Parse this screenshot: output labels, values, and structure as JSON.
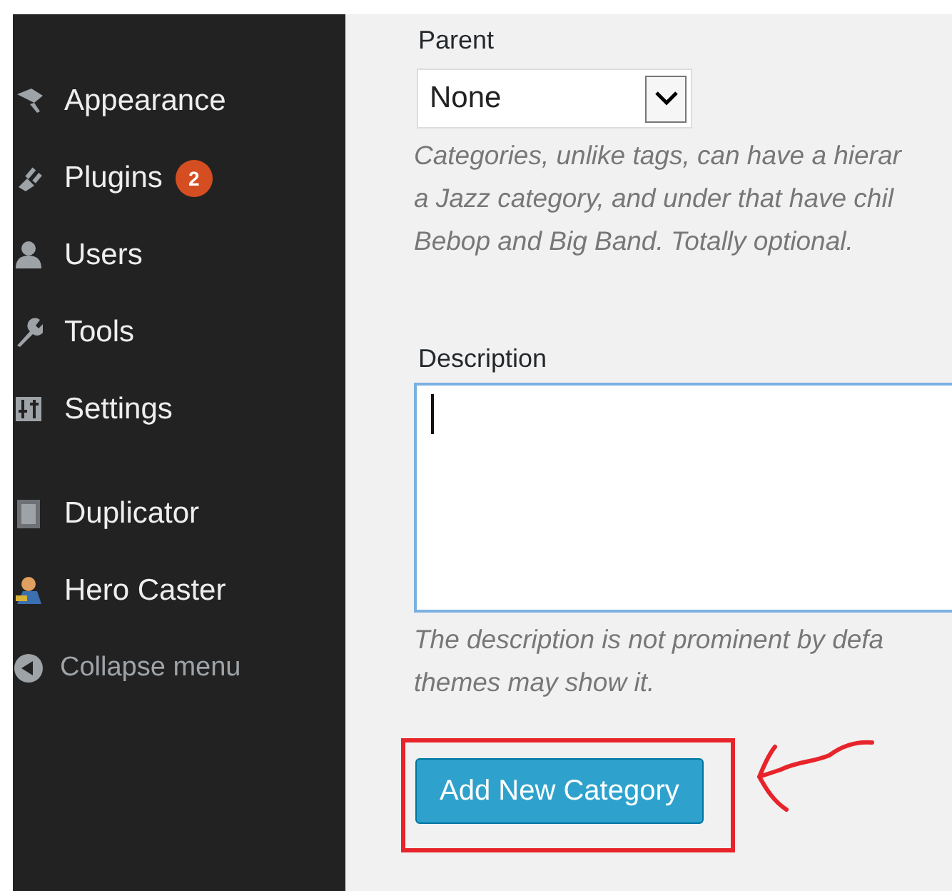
{
  "sidebar": {
    "items": [
      {
        "label": "Appearance"
      },
      {
        "label": "Plugins",
        "badge": "2"
      },
      {
        "label": "Users"
      },
      {
        "label": "Tools"
      },
      {
        "label": "Settings"
      },
      {
        "label": "Duplicator"
      },
      {
        "label": "Hero Caster"
      }
    ],
    "collapse": {
      "label": "Collapse menu"
    }
  },
  "form": {
    "parent": {
      "label": "Parent",
      "value": "None",
      "hint_lines": [
        "Categories, unlike tags, can have a hierar",
        "a Jazz category, and under that have chil",
        "Bebop and Big Band. Totally optional."
      ]
    },
    "description": {
      "label": "Description",
      "focused": true,
      "hint_lines": [
        "The description is not prominent by defa",
        "themes may show it."
      ]
    },
    "submit": {
      "label": "Add New Category",
      "highlighted": true
    }
  }
}
